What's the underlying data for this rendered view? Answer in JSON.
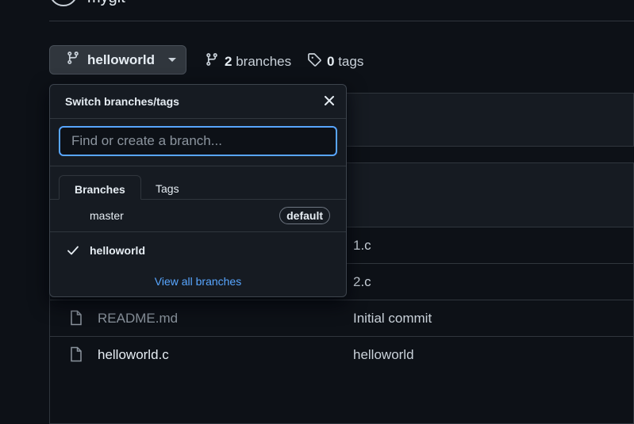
{
  "header": {
    "repo_name": "mygit"
  },
  "branch_button": {
    "label": "helloworld"
  },
  "branches_link": {
    "count": "2",
    "label": "branches"
  },
  "tags_link": {
    "count": "0",
    "label": "tags"
  },
  "files": [
    {
      "name": "",
      "message": "1.c",
      "icon": "file-icon"
    },
    {
      "name": "",
      "message": "2.c",
      "icon": "file-icon"
    },
    {
      "name": "README.md",
      "message": "Initial commit",
      "icon": "file-icon"
    },
    {
      "name": "helloworld.c",
      "message": "helloworld",
      "icon": "file-icon"
    }
  ],
  "dropdown": {
    "title": "Switch branches/tags",
    "search_placeholder": "Find or create a branch...",
    "tabs": [
      {
        "label": "Branches",
        "active": true
      },
      {
        "label": "Tags",
        "active": false
      }
    ],
    "items": [
      {
        "name": "master",
        "badge": "default",
        "selected": false
      },
      {
        "name": "helloworld",
        "badge": "",
        "selected": true
      }
    ],
    "footer_link": "View all branches"
  },
  "colors": {
    "background": "#0d1117",
    "panel": "#161b22",
    "border": "#30363d",
    "accent": "#58a6ff"
  }
}
